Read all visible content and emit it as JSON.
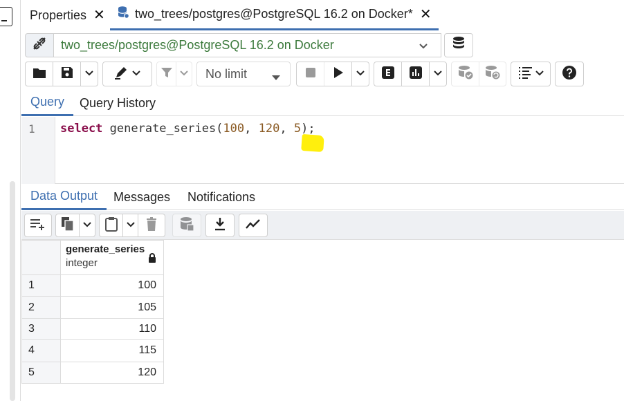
{
  "tabs": {
    "properties_label": "Properties",
    "query_tab_label": "two_trees/postgres@PostgreSQL 16.2 on Docker*"
  },
  "connection": {
    "selected": "two_trees/postgres@PostgreSQL 16.2 on Docker"
  },
  "toolbar": {
    "limit_selected": "No limit"
  },
  "editor_tabs": {
    "query": "Query",
    "history": "Query History"
  },
  "editor": {
    "line_number": "1",
    "kw": "select",
    "fn": " generate_series(",
    "n1": "100",
    "sep1": ", ",
    "n2": "120",
    "sep2": ", ",
    "n3": "5",
    "end": ");"
  },
  "output_tabs": {
    "data_output": "Data Output",
    "messages": "Messages",
    "notifications": "Notifications"
  },
  "result": {
    "column": {
      "name": "generate_series",
      "type": "integer"
    },
    "rows": [
      {
        "n": "1",
        "value": "100"
      },
      {
        "n": "2",
        "value": "105"
      },
      {
        "n": "3",
        "value": "110"
      },
      {
        "n": "4",
        "value": "115"
      },
      {
        "n": "5",
        "value": "120"
      }
    ]
  },
  "colors": {
    "accent": "#3e6fb0",
    "keyword": "#8a0f4b",
    "number": "#8a5a23",
    "connection_text": "#3c7a3c",
    "highlight": "#ffee00"
  }
}
